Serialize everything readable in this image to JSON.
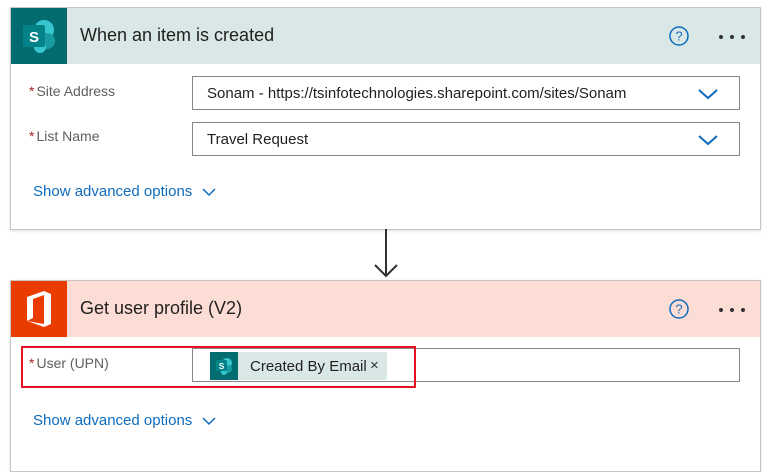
{
  "trigger": {
    "title": "When an item is created",
    "app_icon": "sharepoint-icon",
    "fields": [
      {
        "required_mark": "*",
        "label": "Site Address",
        "value": "Sonam - https://tsinfotechnologies.sharepoint.com/sites/Sonam"
      },
      {
        "required_mark": "*",
        "label": "List Name",
        "value": "Travel Request"
      }
    ],
    "advanced_label": "Show advanced options"
  },
  "action": {
    "title": "Get user profile (V2)",
    "app_icon": "office-icon",
    "field": {
      "required_mark": "*",
      "label": "User (UPN)",
      "token_label": "Created By Email",
      "token_close": "×"
    },
    "advanced_label": "Show advanced options"
  },
  "colors": {
    "sharepoint_header": "#d9e8e6",
    "sharepoint_brand": "#036c70",
    "office_header": "#fbddd6",
    "office_brand": "#eb3c00",
    "link": "#0f6cbd",
    "highlight": "#e81123"
  }
}
